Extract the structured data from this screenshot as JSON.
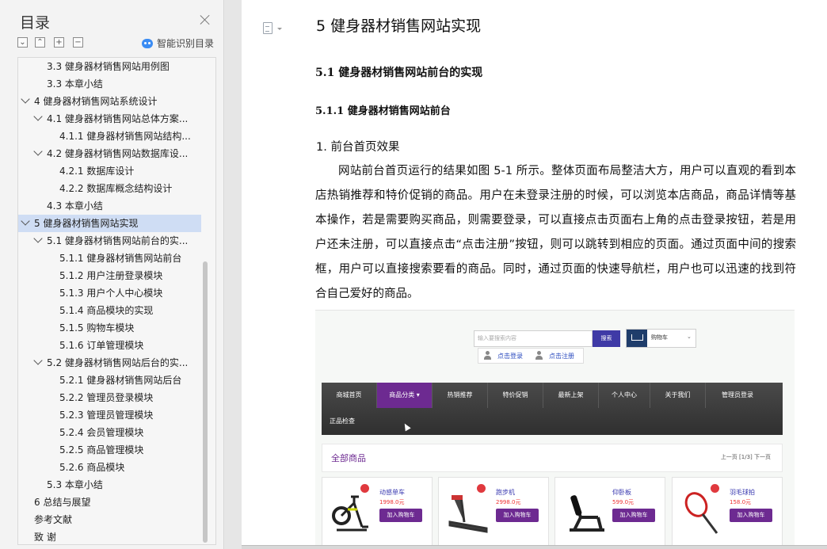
{
  "toc": {
    "title": "目录",
    "smart_label": "智能识别目录",
    "tools": [
      "⌄",
      "⌃",
      "+",
      "−"
    ],
    "items": [
      {
        "label": "3.3  健身器材销售网站用例图",
        "level": 2,
        "chevron": false,
        "active": false
      },
      {
        "label": "3.3  本章小结",
        "level": 2,
        "chevron": false,
        "active": false
      },
      {
        "label": "4  健身器材销售网站系统设计",
        "level": 1,
        "chevron": true,
        "active": false
      },
      {
        "label": "4.1  健身器材销售网站总体方案...",
        "level": 2,
        "chevron": true,
        "active": false
      },
      {
        "label": "4.1.1  健身器材销售网站结构...",
        "level": 3,
        "chevron": false,
        "active": false
      },
      {
        "label": "4.2  健身器材销售网站数据库设...",
        "level": 2,
        "chevron": true,
        "active": false
      },
      {
        "label": "4.2.1  数据库设计",
        "level": 3,
        "chevron": false,
        "active": false
      },
      {
        "label": "4.2.2  数据库概念结构设计",
        "level": 3,
        "chevron": false,
        "active": false
      },
      {
        "label": "4.3  本章小结",
        "level": 2,
        "chevron": false,
        "active": false
      },
      {
        "label": "5  健身器材销售网站实现",
        "level": 1,
        "chevron": true,
        "active": true
      },
      {
        "label": "5.1  健身器材销售网站前台的实...",
        "level": 2,
        "chevron": true,
        "active": false
      },
      {
        "label": "5.1.1  健身器材销售网站前台",
        "level": 3,
        "chevron": false,
        "active": false
      },
      {
        "label": "5.1.2 用户注册登录模块",
        "level": 3,
        "chevron": false,
        "active": false
      },
      {
        "label": "5.1.3  用户个人中心模块",
        "level": 3,
        "chevron": false,
        "active": false
      },
      {
        "label": "5.1.4  商品模块的实现",
        "level": 3,
        "chevron": false,
        "active": false
      },
      {
        "label": "5.1.5  购物车模块",
        "level": 3,
        "chevron": false,
        "active": false
      },
      {
        "label": "5.1.6  订单管理模块",
        "level": 3,
        "chevron": false,
        "active": false
      },
      {
        "label": "5.2  健身器材销售网站后台的实...",
        "level": 2,
        "chevron": true,
        "active": false
      },
      {
        "label": "5.2.1  健身器材销售网站后台",
        "level": 3,
        "chevron": false,
        "active": false
      },
      {
        "label": "5.2.2  管理员登录模块",
        "level": 3,
        "chevron": false,
        "active": false
      },
      {
        "label": "5.2.3  管理员管理模块",
        "level": 3,
        "chevron": false,
        "active": false
      },
      {
        "label": "5.2.4  会员管理模块",
        "level": 3,
        "chevron": false,
        "active": false
      },
      {
        "label": "5.2.5  商品管理模块",
        "level": 3,
        "chevron": false,
        "active": false
      },
      {
        "label": "5.2.6  商品模块",
        "level": 3,
        "chevron": false,
        "active": false
      },
      {
        "label": "5.3  本章小结",
        "level": 2,
        "chevron": false,
        "active": false
      },
      {
        "label": "6  总结与展望",
        "level": 1,
        "chevron": false,
        "active": false
      },
      {
        "label": "参考文献",
        "level": 0,
        "chevron": false,
        "active": false
      },
      {
        "label": "致    谢",
        "level": 0,
        "chevron": false,
        "active": false
      }
    ]
  },
  "doc": {
    "h1": "5  健身器材销售网站实现",
    "h2": "5.1  健身器材销售网站前台的实现",
    "h3": "5.1.1  健身器材销售网站前台",
    "h4": "1. 前台首页效果",
    "paragraph": "网站前台首页运行的结果如图 5-1 所示。整体页面布局整洁大方，用户可以直观的看到本店热销推荐和特价促销的商品。用户在未登录注册的时候，可以浏览本店商品，商品详情等基本操作，若是需要购买商品，则需要登录，可以直接点击页面右上角的点击登录按钮，若是用户还未注册，可以直接点击“点击注册”按钮，则可以跳转到相应的页面。通过页面中间的搜索框，用户可以直接搜索要看的商品。同时，通过页面的快速导航栏，用户也可以迅速的找到符合自己爱好的商品。"
  },
  "figure": {
    "search_placeholder": "输入要搜索内容",
    "search_button": "搜索",
    "cart_label": "购物车",
    "cart_caret": "⌄",
    "login_link": "点击登录",
    "register_link": "点击注册",
    "nav": [
      "商城首页",
      "商品分类 ▾",
      "热销推荐",
      "特价促销",
      "最新上架",
      "个人中心",
      "关于我们",
      "管理员登录"
    ],
    "nav_row2": "正品检查",
    "all_products": "全部商品",
    "pager": "上一页 [1/3] 下一页",
    "products": [
      {
        "name": "动感单车",
        "price": "1998.0元",
        "button": "加入购物车"
      },
      {
        "name": "跑步机",
        "price": "2998.0元",
        "button": "加入购物车"
      },
      {
        "name": "仰卧板",
        "price": "599.0元",
        "button": "加入购物车"
      },
      {
        "name": "羽毛球拍",
        "price": "158.0元",
        "button": "加入购物车"
      }
    ]
  }
}
